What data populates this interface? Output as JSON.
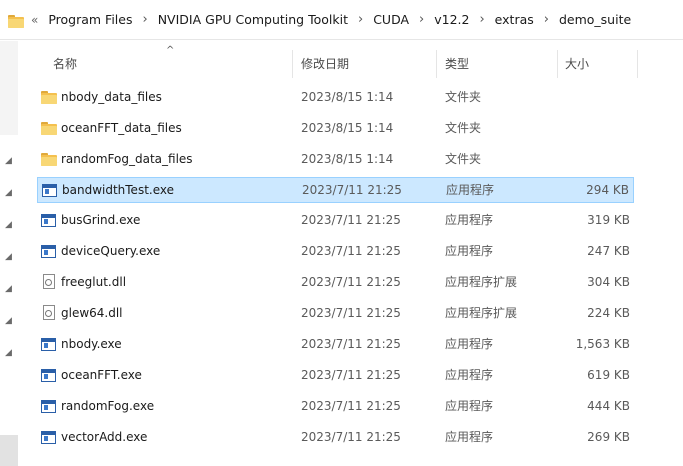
{
  "breadcrumb": {
    "overflow": "«",
    "items": [
      "Program Files",
      "NVIDIA GPU Computing Toolkit",
      "CUDA",
      "v12.2",
      "extras",
      "demo_suite"
    ],
    "separator": "›"
  },
  "columns": {
    "name": "名称",
    "date": "修改日期",
    "type": "类型",
    "size": "大小",
    "sort_indicator": "^"
  },
  "files": [
    {
      "name": "nbody_data_files",
      "date": "2023/8/15 1:14",
      "type": "文件夹",
      "size": "",
      "icon": "folder-icon"
    },
    {
      "name": "oceanFFT_data_files",
      "date": "2023/8/15 1:14",
      "type": "文件夹",
      "size": "",
      "icon": "folder-icon"
    },
    {
      "name": "randomFog_data_files",
      "date": "2023/8/15 1:14",
      "type": "文件夹",
      "size": "",
      "icon": "folder-icon"
    },
    {
      "name": "bandwidthTest.exe",
      "date": "2023/7/11 21:25",
      "type": "应用程序",
      "size": "294 KB",
      "icon": "exe-icon",
      "selected": true
    },
    {
      "name": "busGrind.exe",
      "date": "2023/7/11 21:25",
      "type": "应用程序",
      "size": "319 KB",
      "icon": "exe-icon"
    },
    {
      "name": "deviceQuery.exe",
      "date": "2023/7/11 21:25",
      "type": "应用程序",
      "size": "247 KB",
      "icon": "exe-icon"
    },
    {
      "name": "freeglut.dll",
      "date": "2023/7/11 21:25",
      "type": "应用程序扩展",
      "size": "304 KB",
      "icon": "dll-icon"
    },
    {
      "name": "glew64.dll",
      "date": "2023/7/11 21:25",
      "type": "应用程序扩展",
      "size": "224 KB",
      "icon": "dll-icon"
    },
    {
      "name": "nbody.exe",
      "date": "2023/7/11 21:25",
      "type": "应用程序",
      "size": "1,563 KB",
      "icon": "exe-icon"
    },
    {
      "name": "oceanFFT.exe",
      "date": "2023/7/11 21:25",
      "type": "应用程序",
      "size": "619 KB",
      "icon": "exe-icon"
    },
    {
      "name": "randomFog.exe",
      "date": "2023/7/11 21:25",
      "type": "应用程序",
      "size": "444 KB",
      "icon": "exe-icon"
    },
    {
      "name": "vectorAdd.exe",
      "date": "2023/7/11 21:25",
      "type": "应用程序",
      "size": "269 KB",
      "icon": "exe-icon"
    }
  ],
  "colors": {
    "selection_bg": "#cce8ff",
    "selection_border": "#99d1ff",
    "folder": "#f4c04e",
    "exe": "#2a5fa8"
  }
}
